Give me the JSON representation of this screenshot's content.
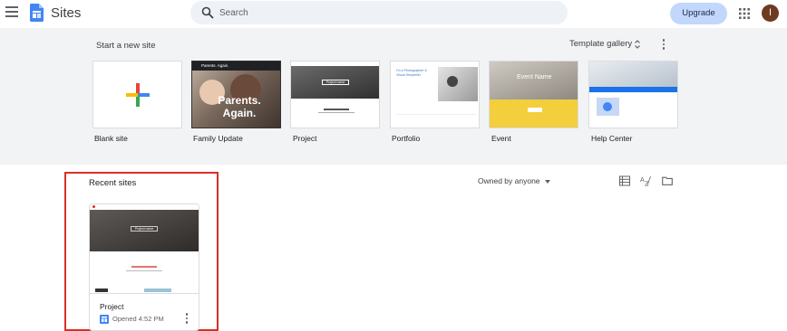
{
  "header": {
    "app_title": "Sites",
    "search_placeholder": "Search",
    "upgrade_label": "Upgrade",
    "avatar_initial": "I"
  },
  "templates": {
    "section_title": "Start a new site",
    "gallery_label": "Template gallery",
    "items": [
      {
        "label": "Blank site"
      },
      {
        "label": "Family Update",
        "thumb_title": "Parents. Again.",
        "thumb_header": "Parents. Again."
      },
      {
        "label": "Project",
        "thumb_title": "Project name"
      },
      {
        "label": "Portfolio",
        "thumb_title": "I'm a Photographer & Visual Storyteller"
      },
      {
        "label": "Event",
        "thumb_title": "Event Name"
      },
      {
        "label": "Help Center"
      }
    ]
  },
  "recent": {
    "title": "Recent sites",
    "owner_filter": "Owned by anyone",
    "sites": [
      {
        "name": "Project",
        "opened": "Opened 4:52 PM",
        "thumb_title": "Project name"
      }
    ]
  },
  "colors": {
    "accent": "#c2d7fb",
    "band": "#f1f3f4",
    "highlight": "#d93025",
    "sites_blue": "#4285f4"
  }
}
